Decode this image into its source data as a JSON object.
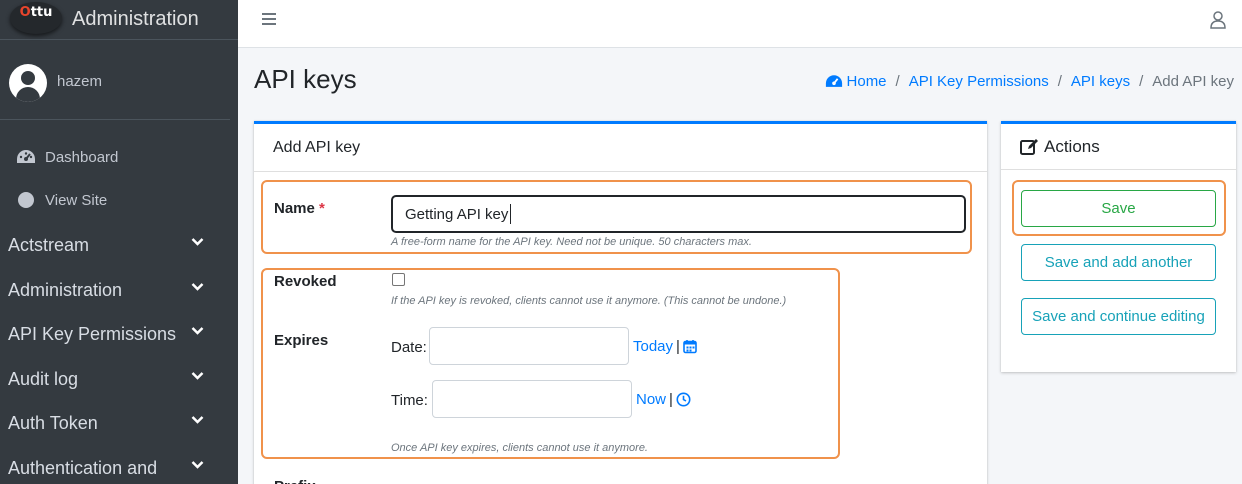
{
  "brand": {
    "logo_text": "Ottu",
    "title": "Administration"
  },
  "user": {
    "name": "hazem"
  },
  "sidebar": {
    "links": [
      {
        "label": "Dashboard",
        "icon": "tachometer-icon"
      },
      {
        "label": "View Site",
        "icon": "circle-icon"
      }
    ],
    "sections": [
      {
        "label": "Actstream"
      },
      {
        "label": "Administration"
      },
      {
        "label": "API Key Permissions"
      },
      {
        "label": "Audit log"
      },
      {
        "label": "Auth Token"
      },
      {
        "label": "Authentication and"
      }
    ]
  },
  "page": {
    "title": "API keys",
    "breadcrumb": [
      "Home",
      "API Key Permissions",
      "API keys",
      "Add API key"
    ]
  },
  "form": {
    "card_title": "Add API key",
    "name": {
      "label": "Name",
      "required_mark": "*",
      "value": "Getting API key",
      "help": "A free-form name for the API key. Need not be unique. 50 characters max."
    },
    "revoked": {
      "label": "Revoked",
      "checked": false,
      "help": "If the API key is revoked, clients cannot use it anymore. (This cannot be undone.)"
    },
    "expires": {
      "label": "Expires",
      "date_label": "Date:",
      "date_value": "",
      "today_link": "Today",
      "time_label": "Time:",
      "time_value": "",
      "now_link": "Now",
      "help": "Once API key expires, clients cannot use it anymore."
    },
    "next_label_partial": "Prefix"
  },
  "actions": {
    "title": "Actions",
    "save": "Save",
    "save_add_another": "Save and add another",
    "save_continue": "Save and continue editing"
  },
  "colors": {
    "sidebar_bg": "#343a40",
    "primary": "#007bff",
    "success": "#28a745",
    "info": "#17a2b8",
    "highlight": "#f0924b"
  }
}
